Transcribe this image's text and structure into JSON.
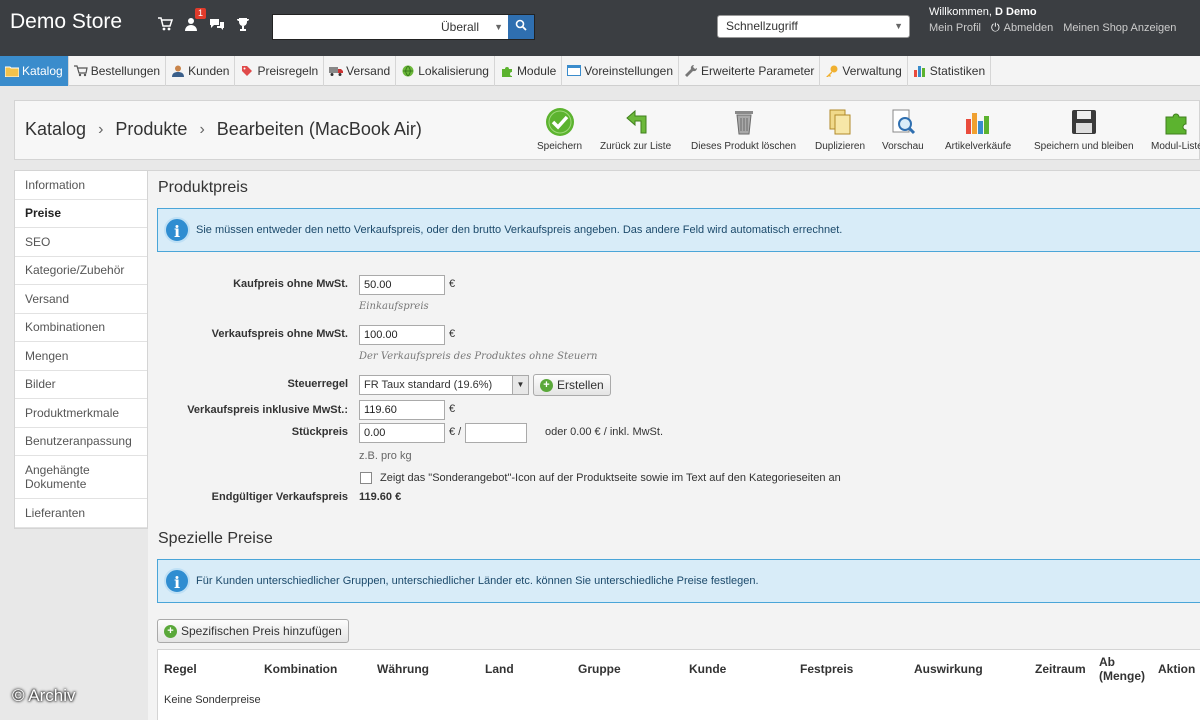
{
  "header": {
    "store_name": "Demo Store",
    "notification_count": "1",
    "search_placeholder": "",
    "search_scope": "Überall",
    "quick_access": "Schnellzugriff",
    "welcome_prefix": "Willkommen,",
    "welcome_user": "D Demo",
    "link_profile": "Mein Profil",
    "link_logout": "Abmelden",
    "link_shop": "Meinen Shop Anzeigen"
  },
  "nav": {
    "items": [
      {
        "label": "Katalog",
        "icon": "folder-icon",
        "active": true
      },
      {
        "label": "Bestellungen",
        "icon": "cart-icon"
      },
      {
        "label": "Kunden",
        "icon": "user-icon"
      },
      {
        "label": "Preisregeln",
        "icon": "price-tag-icon"
      },
      {
        "label": "Versand",
        "icon": "truck-icon"
      },
      {
        "label": "Lokalisierung",
        "icon": "globe-icon"
      },
      {
        "label": "Module",
        "icon": "puzzle-icon"
      },
      {
        "label": "Voreinstellungen",
        "icon": "preferences-icon"
      },
      {
        "label": "Erweiterte Parameter",
        "icon": "wrench-icon"
      },
      {
        "label": "Verwaltung",
        "icon": "key-icon"
      },
      {
        "label": "Statistiken",
        "icon": "stats-icon"
      }
    ]
  },
  "toolbar": {
    "crumb1": "Katalog",
    "crumb2": "Produkte",
    "crumb3": "Bearbeiten (MacBook Air)",
    "save": "Speichern",
    "back": "Zurück zur Liste",
    "delete": "Dieses Produkt löschen",
    "duplicate": "Duplizieren",
    "preview": "Vorschau",
    "sales": "Artikelverkäufe",
    "save_stay": "Speichern und bleiben",
    "module_list": "Modul-Liste"
  },
  "sidebar": {
    "items": [
      {
        "label": "Information"
      },
      {
        "label": "Preise",
        "active": true
      },
      {
        "label": "SEO"
      },
      {
        "label": "Kategorie/Zubehör"
      },
      {
        "label": "Versand"
      },
      {
        "label": "Kombinationen"
      },
      {
        "label": "Mengen"
      },
      {
        "label": "Bilder"
      },
      {
        "label": "Produktmerkmale"
      },
      {
        "label": "Benutzeranpassung"
      },
      {
        "label": "Angehängte Dokumente"
      },
      {
        "label": "Lieferanten"
      }
    ]
  },
  "price": {
    "title": "Produktpreis",
    "info": "Sie müssen entweder den netto Verkaufspreis, oder den brutto Verkaufspreis angeben. Das andere Feld wird automatisch errechnet.",
    "purchase_label": "Kaufpreis ohne MwSt.",
    "purchase_value": "50.00",
    "purchase_hint": "Einkaufspreis",
    "sale_label": "Verkaufspreis ohne MwSt.",
    "sale_value": "100.00",
    "sale_hint": "Der Verkaufspreis des Produktes ohne Steuern",
    "tax_label": "Steuerregel",
    "tax_value": "FR Taux standard (19.6%)",
    "create_label": "Erstellen",
    "sale_incl_label": "Verkaufspreis inklusive MwSt.:",
    "sale_incl_value": "119.60",
    "unit_label": "Stückpreis",
    "unit_value": "0.00",
    "unit_unit_value": "",
    "unit_suffix": "oder 0.00 € / inkl. MwSt.",
    "unit_hint": "z.B. pro kg",
    "special_checkbox": "Zeigt das \"Sonderangebot\"-Icon auf der Produktseite sowie im Text auf den Kategorieseiten an",
    "final_label": "Endgültiger Verkaufspreis",
    "final_value": "119.60 €",
    "currency": "€",
    "currency_slash": "€ /"
  },
  "special": {
    "title": "Spezielle Preise",
    "info": "Für Kunden unterschiedlicher Gruppen, unterschiedlicher Länder etc. können Sie unterschiedliche Preise festlegen.",
    "add_label": "Spezifischen Preis hinzufügen",
    "columns": [
      "Regel",
      "Kombination",
      "Währung",
      "Land",
      "Gruppe",
      "Kunde",
      "Festpreis",
      "Auswirkung",
      "Zeitraum",
      "Ab (Menge)",
      "Aktion"
    ],
    "empty": "Keine Sonderpreise"
  },
  "watermark": "© Archiv"
}
